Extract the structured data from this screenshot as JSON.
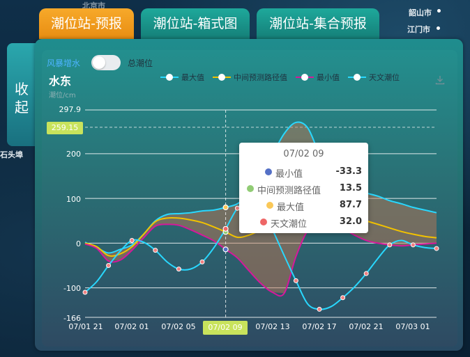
{
  "map": {
    "labels": [
      "北京市",
      "韶山市",
      "江门市",
      "石头埠"
    ]
  },
  "tabs": [
    {
      "label": "潮位站-预报",
      "active": true
    },
    {
      "label": "潮位站-箱式图",
      "active": false
    },
    {
      "label": "潮位站-集合预报",
      "active": false
    }
  ],
  "collapse": {
    "label_1": "收",
    "label_2": "起"
  },
  "toggle": {
    "left_label": "风暴增水",
    "right_label": "总潮位",
    "on": false
  },
  "station": {
    "name": "水东",
    "unit": "潮位/cm"
  },
  "legend": [
    {
      "name": "最大值",
      "color": "#29d8ff"
    },
    {
      "name": "中间预测路径值",
      "color": "#f2c200"
    },
    {
      "name": "最小值",
      "color": "#d6189b"
    },
    {
      "name": "天文潮位",
      "color": "#29d8ff"
    }
  ],
  "tooltip": {
    "title": "07/02 09",
    "rows": [
      {
        "name": "最小值",
        "value": "-33.3",
        "color": "#5470c6"
      },
      {
        "name": "中间预测路径值",
        "value": "13.5",
        "color": "#91cc75"
      },
      {
        "name": "最大值",
        "value": "87.7",
        "color": "#fac858"
      },
      {
        "name": "天文潮位",
        "value": "32.0",
        "color": "#ee6666"
      }
    ]
  },
  "chart_data": {
    "type": "line",
    "ylim": [
      -166,
      297.9
    ],
    "yticks": [
      "297.9",
      "200",
      "100",
      "0",
      "-100",
      "-166"
    ],
    "y_marker": "259.15",
    "x_axis_labels": [
      "07/01 21",
      "07/02 01",
      "07/02 05",
      "07/02 09",
      "07/02 13",
      "07/02 17",
      "07/02 21",
      "07/03 01"
    ],
    "x_highlight": "07/02 09",
    "x_hours": [
      0,
      1,
      2,
      3,
      4,
      5,
      6,
      7,
      8,
      9,
      10,
      11,
      12,
      13,
      14,
      15,
      16,
      17,
      18,
      19,
      20,
      21,
      22,
      23,
      24,
      25,
      26,
      27,
      28,
      29,
      30
    ],
    "series": [
      {
        "name": "最大值",
        "color": "#29d8ff",
        "values": [
          2,
          -10,
          -22,
          -14,
          -4,
          20,
          50,
          64,
          66,
          68,
          72,
          74,
          80,
          88,
          110,
          150,
          198,
          245,
          270,
          258,
          200,
          160,
          135,
          120,
          112,
          105,
          95,
          88,
          80,
          74,
          68
        ]
      },
      {
        "name": "中间预测路径值",
        "color": "#f2c200",
        "values": [
          0,
          -8,
          -28,
          -24,
          -8,
          20,
          48,
          56,
          56,
          52,
          46,
          36,
          25,
          13,
          18,
          30,
          46,
          70,
          90,
          95,
          90,
          82,
          72,
          60,
          50,
          42,
          34,
          26,
          20,
          15,
          12
        ]
      },
      {
        "name": "最小值",
        "color": "#d6189b",
        "values": [
          -2,
          -12,
          -40,
          -38,
          -16,
          12,
          38,
          42,
          40,
          30,
          18,
          5,
          -14,
          -33,
          -62,
          -90,
          -110,
          -112,
          -30,
          28,
          46,
          42,
          32,
          18,
          6,
          0,
          -4,
          -6,
          -4,
          -2,
          0
        ]
      },
      {
        "name": "天文潮位",
        "color": "#29d8ff",
        "values": [
          -110,
          -86,
          -50,
          -18,
          6,
          2,
          -16,
          -42,
          -58,
          -58,
          -42,
          -10,
          32,
          78,
          98,
          84,
          30,
          -28,
          -84,
          -136,
          -148,
          -142,
          -122,
          -98,
          -68,
          -34,
          -4,
          6,
          -4,
          -10,
          -12
        ]
      }
    ]
  }
}
